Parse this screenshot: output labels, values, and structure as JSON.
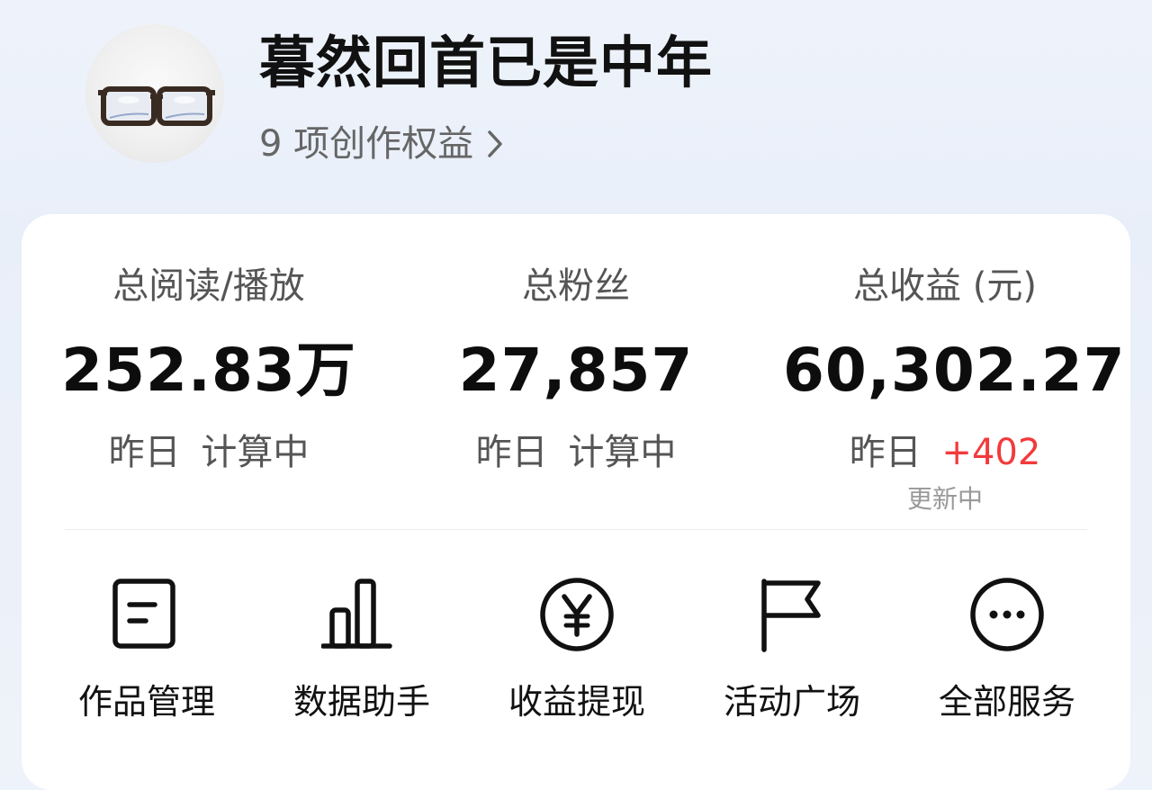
{
  "profile": {
    "name": "暮然回首已是中年",
    "rights_link": "9 项创作权益",
    "avatar_icon": "glasses-avatar"
  },
  "stats": [
    {
      "label": "总阅读/播放",
      "value": "252.83万",
      "sub_prefix": "昨日",
      "sub_value": "计算中"
    },
    {
      "label": "总粉丝",
      "value": "27,857",
      "sub_prefix": "昨日",
      "sub_value": "计算中"
    },
    {
      "label": "总收益 (元)",
      "value": "60,302.27",
      "sub_prefix": "昨日",
      "sub_value": "+402",
      "note": "更新中"
    }
  ],
  "services": [
    {
      "label": "作品管理",
      "icon": "document-icon"
    },
    {
      "label": "数据助手",
      "icon": "bar-chart-icon"
    },
    {
      "label": "收益提现",
      "icon": "yen-icon"
    },
    {
      "label": "活动广场",
      "icon": "flag-icon"
    },
    {
      "label": "全部服务",
      "icon": "more-icon"
    }
  ],
  "colors": {
    "delta_positive": "#f23a3c",
    "background": "#eef3fb",
    "card": "#ffffff"
  }
}
